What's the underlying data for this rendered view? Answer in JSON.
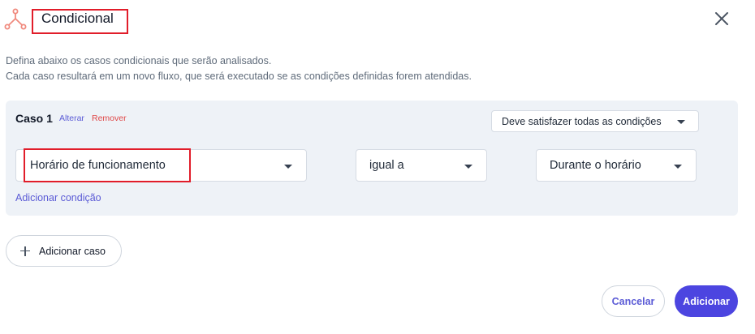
{
  "colors": {
    "accent": "#4c45e0",
    "link": "#5b5bd6",
    "danger": "#e04848",
    "highlight": "#e11d2a",
    "panel": "#eef2f7",
    "icon": "#f08a7e"
  },
  "header": {
    "icon": "flow-split-icon",
    "title": "Condicional",
    "close_icon": "close-icon"
  },
  "description": {
    "line1": "Defina abaixo os casos condicionais que serão analisados.",
    "line2": "Cada caso resultará em um novo fluxo, que será executado se as condições definidas forem atendidas."
  },
  "case": {
    "title": "Caso 1",
    "edit_label": "Alterar",
    "remove_label": "Remover",
    "match_mode": "Deve satisfazer todas as condições",
    "condition": {
      "field": "Horário de funcionamento",
      "operator": "igual a",
      "value": "Durante o horário"
    },
    "add_condition_label": "Adicionar condição"
  },
  "add_case_label": "Adicionar caso",
  "footer": {
    "cancel_label": "Cancelar",
    "submit_label": "Adicionar"
  }
}
